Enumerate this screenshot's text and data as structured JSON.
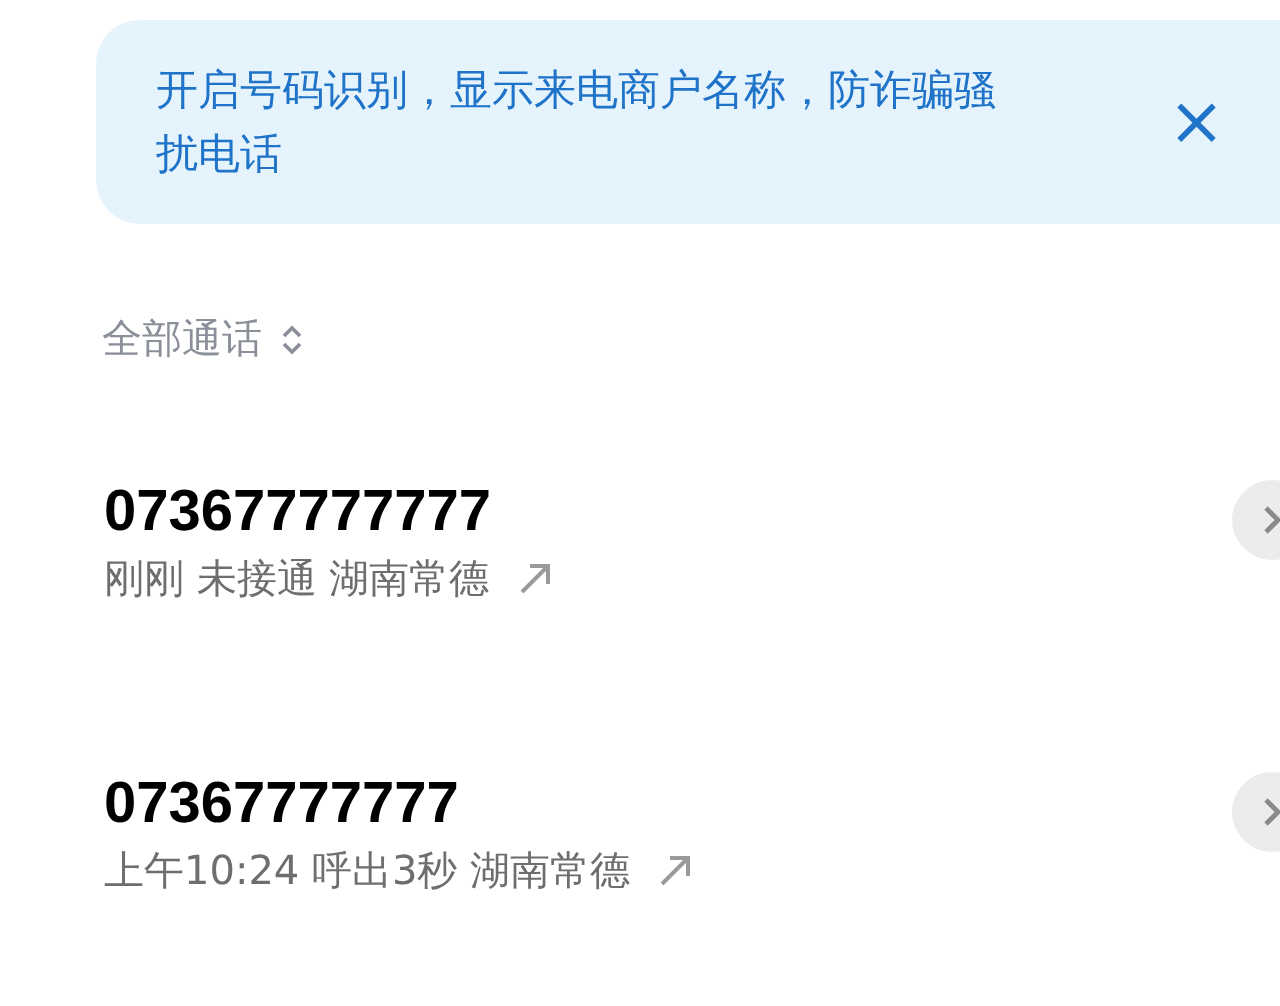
{
  "banner": {
    "text": "开启号码识别，显示来电商户名称，防诈骗骚扰电话",
    "close": "×"
  },
  "filter": {
    "label": "全部通话"
  },
  "calls": [
    {
      "number": "073677777777",
      "detail": "刚刚 未接通 湖南常德"
    },
    {
      "number": "07367777777",
      "detail": "上午10:24 呼出3秒 湖南常德"
    }
  ]
}
